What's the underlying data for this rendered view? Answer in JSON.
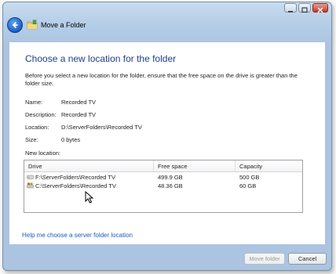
{
  "window": {
    "title": "Move a Folder"
  },
  "main": {
    "heading": "Choose a new location for the folder",
    "description": "Before you select a new location for the folder, ensure that the free space on the drive is greater than the folder size.",
    "details": [
      {
        "label": "Name:",
        "value": "Recorded TV"
      },
      {
        "label": "Description:",
        "value": "Recorded TV"
      },
      {
        "label": "Location:",
        "value": "D:\\ServerFolders\\Recorded TV"
      },
      {
        "label": "Size:",
        "value": "0 bytes"
      }
    ],
    "new_location_label": "New location:",
    "table": {
      "columns": [
        "Drive",
        "Free space",
        "Capacity"
      ],
      "rows": [
        {
          "drive": "F:\\ServerFolders\\Recorded TV",
          "free": "499.9 GB",
          "capacity": "500 GB",
          "icon": "external-drive-icon"
        },
        {
          "drive": "C:\\ServerFolders\\Recorded TV",
          "free": "48.36 GB",
          "capacity": "60 GB",
          "icon": "system-drive-icon"
        }
      ]
    },
    "help_link": "Help me choose a server folder location"
  },
  "buttons": {
    "move": "Move folder",
    "cancel": "Cancel"
  },
  "colors": {
    "heading": "#1e3f8a",
    "link": "#1c5bb8",
    "accent": "#1c5ec7"
  }
}
